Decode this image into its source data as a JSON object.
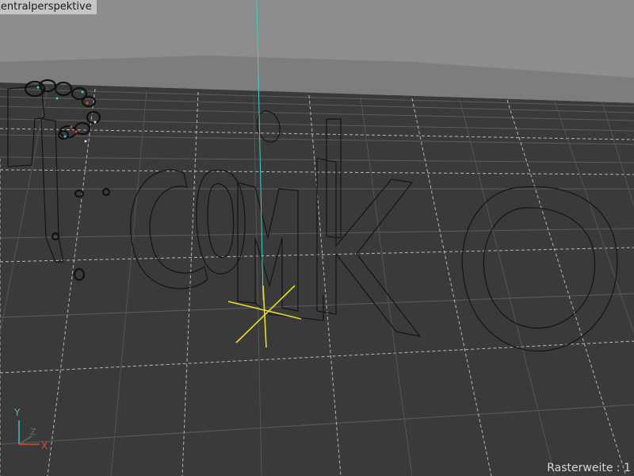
{
  "viewport": {
    "view_label": "Zentralperspektive",
    "grid_spacing_label": "Rasterweite : 1"
  },
  "axis_gizmo": {
    "y_label": "Y",
    "z_label": "Z",
    "x_label": "X"
  },
  "colors": {
    "sky": "#8d8d8d",
    "floor": "#3a3a3a",
    "grid_minor": "#5c5c5c",
    "grid_major": "#d0d0d0",
    "spline": "#141414",
    "vertical_axis": "#3fd1c1",
    "pivot": "#e8dc2a",
    "axis_y": "#39c6b6",
    "axis_z": "#6a6a6a",
    "axis_x": "#e04a2a"
  }
}
